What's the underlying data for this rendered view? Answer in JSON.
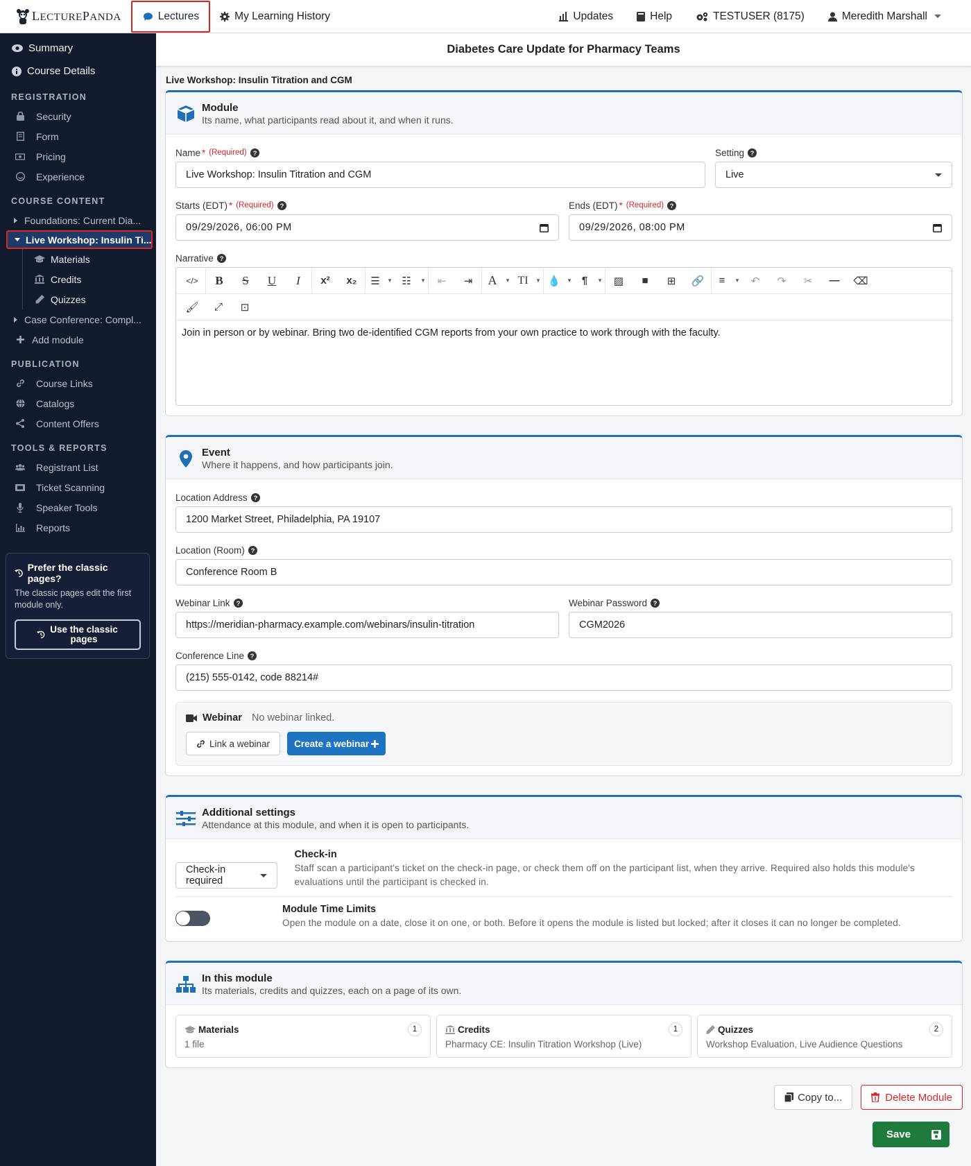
{
  "brand": {
    "logo_text_main": "ECTURE",
    "logo_text_L": "L",
    "logo_text_P": "P",
    "logo_text_tail": "ANDA"
  },
  "topnav": {
    "lectures": "Lectures",
    "history": "My Learning History",
    "updates": "Updates",
    "help": "Help",
    "account": "TESTUSER (8175)",
    "user": "Meredith Marshall"
  },
  "sidebar": {
    "summary": "Summary",
    "course_details": "Course Details",
    "registration_head": "REGISTRATION",
    "registration": [
      "Security",
      "Form",
      "Pricing",
      "Experience"
    ],
    "content_head": "COURSE CONTENT",
    "module1": "Foundations: Current Dia...",
    "module2": "Live Workshop: Insulin Ti...",
    "sub": [
      "Materials",
      "Credits",
      "Quizzes"
    ],
    "module3": "Case Conference: Compl...",
    "add_module": "Add module",
    "publication_head": "PUBLICATION",
    "publication": [
      "Course Links",
      "Catalogs",
      "Content Offers"
    ],
    "tools_head": "TOOLS & REPORTS",
    "tools": [
      "Registrant List",
      "Ticket Scanning",
      "Speaker Tools",
      "Reports"
    ],
    "classic_title": "Prefer the classic pages?",
    "classic_text": "The classic pages edit the first module only.",
    "classic_button": "Use the classic pages"
  },
  "page": {
    "course_title": "Diabetes Care Update for Pharmacy Teams",
    "breadcrumb": "Live Workshop: Insulin Titration and CGM"
  },
  "module_card": {
    "title": "Module",
    "subtitle": "Its name, what participants read about it, and when it runs.",
    "name_label": "Name",
    "required_text": "(Required)",
    "name_value": "Live Workshop: Insulin Titration and CGM",
    "setting_label": "Setting",
    "setting_value": "Live",
    "starts_label": "Starts (EDT)",
    "starts_value": "09/29/2026, 06:00 PM",
    "ends_label": "Ends (EDT)",
    "ends_value": "09/29/2026, 08:00 PM",
    "narrative_label": "Narrative",
    "narrative_text": "Join in person or by webinar. Bring two de-identified CGM reports from your own practice to work through with the faculty."
  },
  "event_card": {
    "title": "Event",
    "subtitle": "Where it happens, and how participants join.",
    "address_label": "Location Address",
    "address_value": "1200 Market Street, Philadelphia, PA 19107",
    "room_label": "Location (Room)",
    "room_value": "Conference Room B",
    "webinar_link_label": "Webinar Link",
    "webinar_link_value": "https://meridian-pharmacy.example.com/webinars/insulin-titration",
    "webinar_password_label": "Webinar Password",
    "webinar_password_value": "CGM2026",
    "conference_label": "Conference Line",
    "conference_value": "(215) 555-0142, code 88214#",
    "webinar_title": "Webinar",
    "webinar_status": "No webinar linked.",
    "link_webinar": "Link a webinar",
    "create_webinar": "Create a webinar"
  },
  "additional_card": {
    "title": "Additional settings",
    "subtitle": "Attendance at this module, and when it is open to participants.",
    "checkin_select": "Check-in required",
    "checkin_title": "Check-in",
    "checkin_text": "Staff scan a participant's ticket on the check-in page, or check them off on the participant list, when they arrive. Required also holds this module's evaluations until the participant is checked in.",
    "time_title": "Module Time Limits",
    "time_text": "Open the module on a date, close it on one, or both. Before it opens the module is listed but locked; after it closes it can no longer be completed.",
    "time_enabled": false
  },
  "in_module_card": {
    "title": "In this module",
    "subtitle": "Its materials, credits and quizzes, each on a page of its own.",
    "tiles": [
      {
        "title": "Materials",
        "count": "1",
        "text": "1 file"
      },
      {
        "title": "Credits",
        "count": "1",
        "text": "Pharmacy CE: Insulin Titration Workshop (Live)"
      },
      {
        "title": "Quizzes",
        "count": "2",
        "text": "Workshop Evaluation, Live Audience Questions"
      }
    ]
  },
  "actions": {
    "copy": "Copy to...",
    "delete": "Delete Module",
    "save": "Save"
  },
  "colors": {
    "accent": "#1f74c2",
    "sidebar_bg": "#121a2e",
    "danger": "#dc2626",
    "save": "#1f7a3e"
  }
}
